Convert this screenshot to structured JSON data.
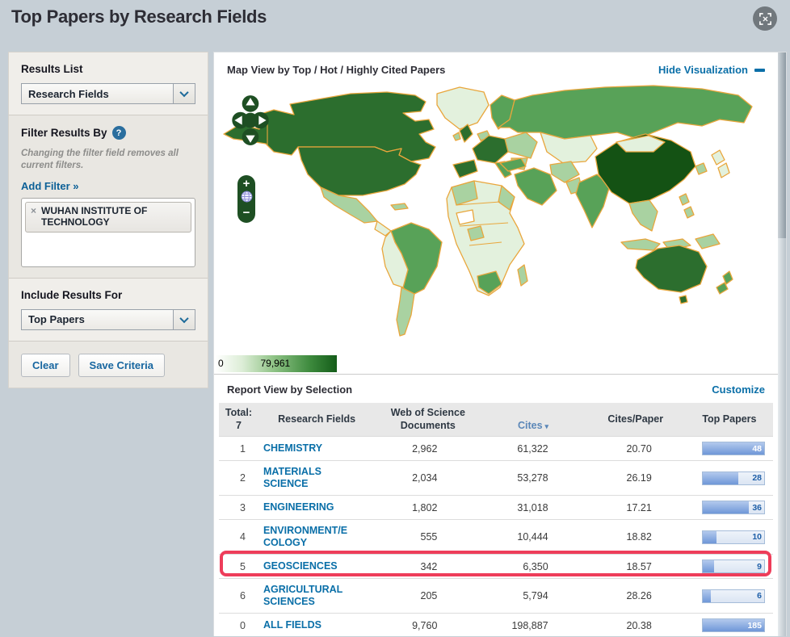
{
  "page": {
    "title": "Top Papers by Research Fields"
  },
  "sidebar": {
    "results_list": {
      "heading": "Results List",
      "selected": "Research Fields"
    },
    "filter": {
      "heading": "Filter Results By",
      "help": "?",
      "note": "Changing the filter field removes all current filters.",
      "add_filter": "Add Filter »",
      "chips": [
        {
          "remove": "×",
          "label": "WUHAN INSTITUTE OF TECHNOLOGY"
        }
      ]
    },
    "include_results": {
      "heading": "Include Results For",
      "selected": "Top Papers"
    },
    "buttons": {
      "clear": "Clear",
      "save": "Save Criteria"
    }
  },
  "map_section": {
    "title": "Map View by Top / Hot / Highly Cited Papers",
    "hide_link": "Hide Visualization",
    "legend": {
      "min": "0",
      "max": "79,961"
    },
    "controls": {
      "zoom_in": "+",
      "zoom_out": "−"
    }
  },
  "report": {
    "title": "Report View by Selection",
    "customize": "Customize",
    "table": {
      "header": {
        "total": "Total:\n7",
        "field": "Research Fields",
        "docs": "Web of Science\nDocuments",
        "cites": "Cites",
        "sort_indicator": "▾",
        "cpp": "Cites/Paper",
        "top": "Top Papers"
      },
      "rows": [
        {
          "rank": "1",
          "field": "CHEMISTRY",
          "docs": "2,962",
          "cites": "61,322",
          "cpp": "20.70",
          "top_papers": "48",
          "bar_pct": 100,
          "highlighted": false
        },
        {
          "rank": "2",
          "field": "MATERIALS\nSCIENCE",
          "docs": "2,034",
          "cites": "53,278",
          "cpp": "26.19",
          "top_papers": "28",
          "bar_pct": 58,
          "highlighted": false
        },
        {
          "rank": "3",
          "field": "ENGINEERING",
          "docs": "1,802",
          "cites": "31,018",
          "cpp": "17.21",
          "top_papers": "36",
          "bar_pct": 75,
          "highlighted": false
        },
        {
          "rank": "4",
          "field": "ENVIRONMENT/E\nCOLOGY",
          "docs": "555",
          "cites": "10,444",
          "cpp": "18.82",
          "top_papers": "10",
          "bar_pct": 22,
          "highlighted": false
        },
        {
          "rank": "5",
          "field": "GEOSCIENCES",
          "docs": "342",
          "cites": "6,350",
          "cpp": "18.57",
          "top_papers": "9",
          "bar_pct": 19,
          "highlighted": true
        },
        {
          "rank": "6",
          "field": "AGRICULTURAL\nSCIENCES",
          "docs": "205",
          "cites": "5,794",
          "cpp": "28.26",
          "top_papers": "6",
          "bar_pct": 13,
          "highlighted": false
        },
        {
          "rank": "0",
          "field": "ALL FIELDS",
          "docs": "9,760",
          "cites": "198,887",
          "cpp": "20.38",
          "top_papers": "185",
          "bar_pct": 100,
          "highlighted": false
        }
      ]
    }
  },
  "colors": {
    "accent_blue": "#0a6fa8",
    "highlight_red": "#ee3d5a",
    "map_darkest": "#145214",
    "map_dark": "#2c6e2e",
    "map_medium": "#58a258",
    "map_border_orange": "#e9a63c",
    "bar_blue": "#6f97d8"
  }
}
